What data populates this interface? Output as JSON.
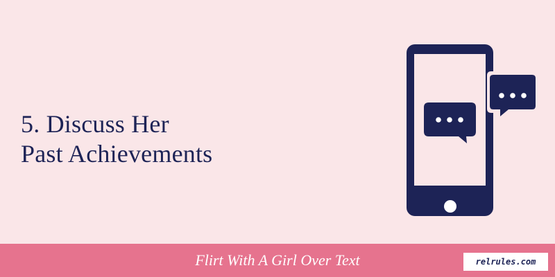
{
  "headline": {
    "line1": "5. Discuss Her",
    "line2": "Past Achievements"
  },
  "footer": {
    "title": "Flirt With A Girl Over Text"
  },
  "brand": {
    "label": "relrules.com"
  },
  "illustration": {
    "icon": "smartphone-chat-icon"
  },
  "colors": {
    "background": "#fae6e8",
    "navy": "#1d2356",
    "pink_bar": "#e6738e"
  }
}
